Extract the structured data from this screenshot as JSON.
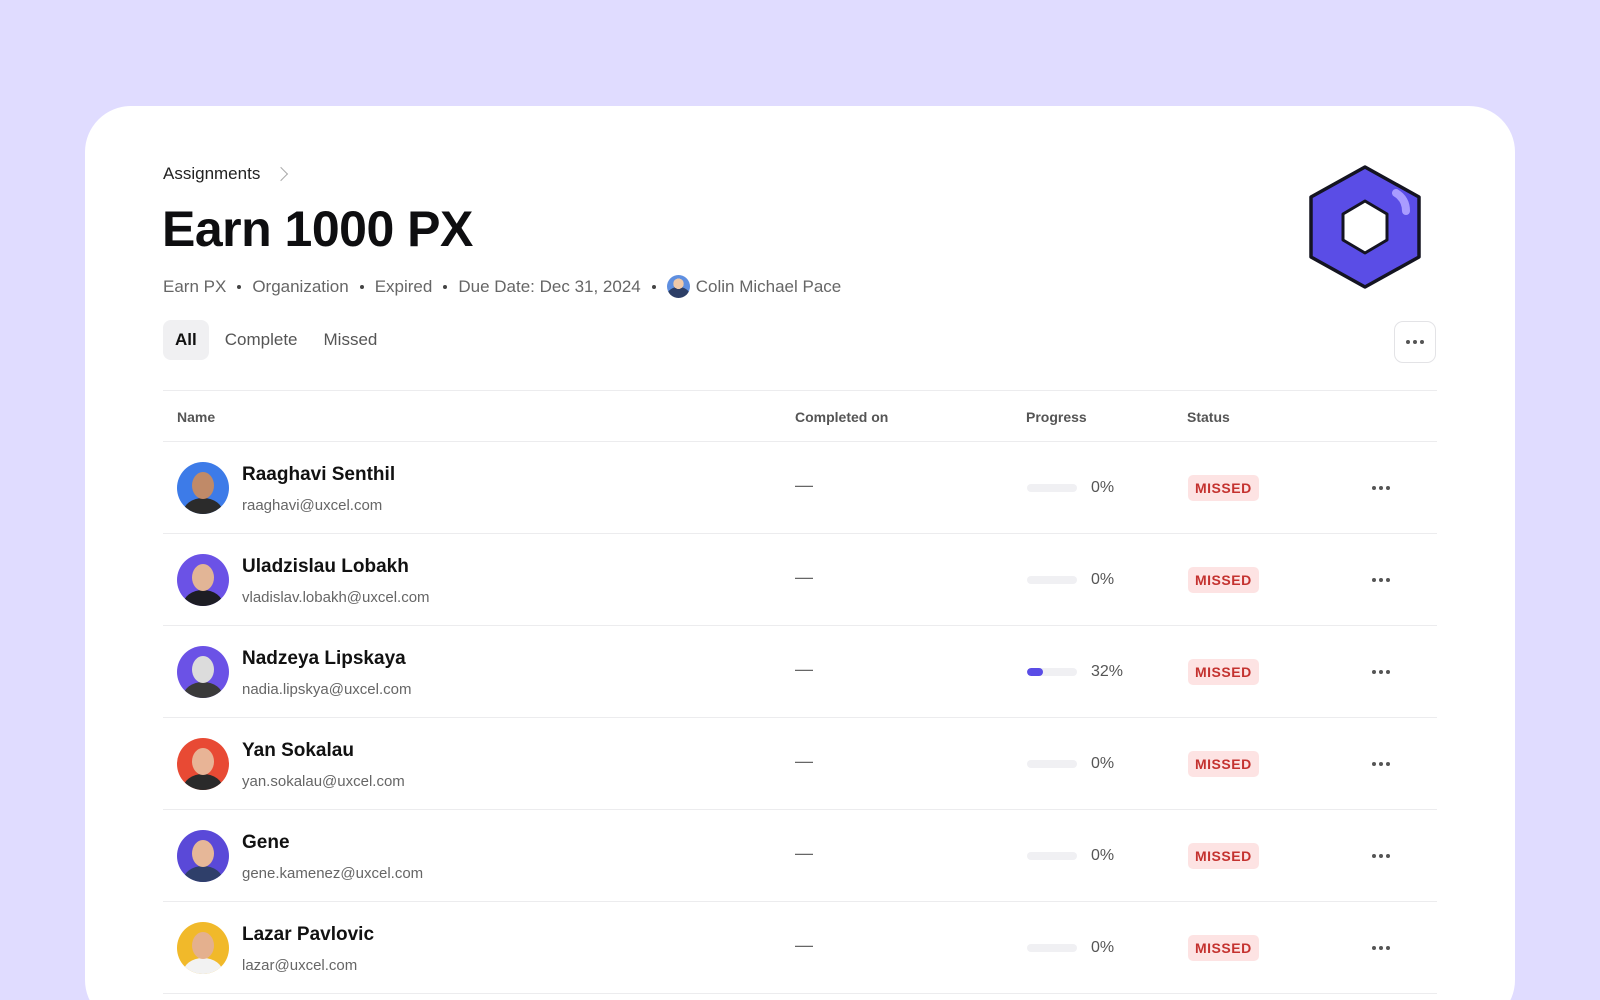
{
  "breadcrumb": {
    "label": "Assignments"
  },
  "page": {
    "title": "Earn 1000 PX",
    "meta": {
      "type": "Earn PX",
      "scope": "Organization",
      "state": "Expired",
      "due": "Due Date: Dec 31, 2024",
      "owner": "Colin Michael Pace"
    }
  },
  "tabs": [
    {
      "label": "All",
      "active": true
    },
    {
      "label": "Complete",
      "active": false
    },
    {
      "label": "Missed",
      "active": false
    }
  ],
  "table": {
    "headers": {
      "name": "Name",
      "completed": "Completed on",
      "progress": "Progress",
      "status": "Status"
    },
    "rows": [
      {
        "name": "Raaghavi Senthil",
        "email": "raaghavi@uxcel.com",
        "completed": "—",
        "progress": 0,
        "progress_label": "0%",
        "status": "MISSED",
        "avatar_bg": "#3d7be8",
        "skin": "#c08a68",
        "shirt": "#2b2b2b"
      },
      {
        "name": "Uladzislau Lobakh",
        "email": "vladislav.lobakh@uxcel.com",
        "completed": "—",
        "progress": 0,
        "progress_label": "0%",
        "status": "MISSED",
        "avatar_bg": "#6b52e6",
        "skin": "#e2b596",
        "shirt": "#1d1d24"
      },
      {
        "name": "Nadzeya Lipskaya",
        "email": "nadia.lipskya@uxcel.com",
        "completed": "—",
        "progress": 32,
        "progress_label": "32%",
        "status": "MISSED",
        "avatar_bg": "#6b52e6",
        "skin": "#dcdcdc",
        "shirt": "#3a3a3a"
      },
      {
        "name": "Yan Sokalau",
        "email": "yan.sokalau@uxcel.com",
        "completed": "—",
        "progress": 0,
        "progress_label": "0%",
        "status": "MISSED",
        "avatar_bg": "#e84a34",
        "skin": "#e8b496",
        "shirt": "#2a2a2a"
      },
      {
        "name": "Gene",
        "email": "gene.kamenez@uxcel.com",
        "completed": "—",
        "progress": 0,
        "progress_label": "0%",
        "status": "MISSED",
        "avatar_bg": "#5a49d8",
        "skin": "#e6b798",
        "shirt": "#2f3f6a"
      },
      {
        "name": "Lazar Pavlovic",
        "email": "lazar@uxcel.com",
        "completed": "—",
        "progress": 0,
        "progress_label": "0%",
        "status": "MISSED",
        "avatar_bg": "#f1b92a",
        "skin": "#e4b08e",
        "shirt": "#f2f2f2"
      }
    ]
  },
  "icons": {
    "logo": "hexagon-badge-icon",
    "more": "more-horizontal-icon",
    "breadcrumb_sep": "chevron-right-icon"
  },
  "colors": {
    "background": "#e0dcff",
    "accent": "#5a4de6",
    "missed_bg": "#fde3e3",
    "missed_text": "#c4322f"
  }
}
